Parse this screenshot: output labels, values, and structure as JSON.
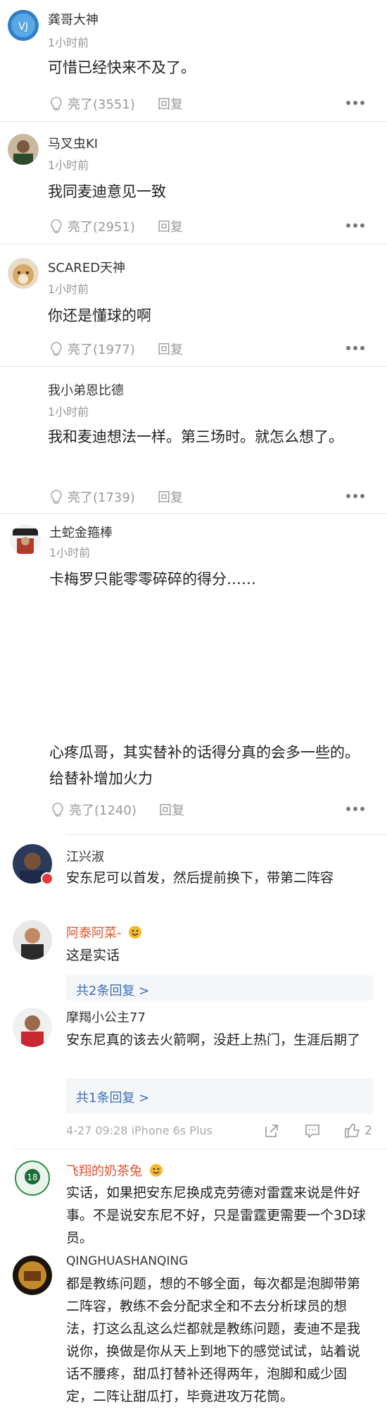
{
  "comments": [
    {
      "user": "龚哥大神",
      "time": "1小时前",
      "text": "可惜已经快来不及了。",
      "likes": "亮了(3551)",
      "reply": "回复"
    },
    {
      "user": "马叉虫KI",
      "time": "1小时前",
      "text": "我同麦迪意见一致",
      "likes": "亮了(2951)",
      "reply": "回复"
    },
    {
      "user": "SCARED天神",
      "time": "1小时前",
      "text": "你还是懂球的啊",
      "likes": "亮了(1977)",
      "reply": "回复"
    },
    {
      "user": "我小弟恩比德",
      "time": "1小时前",
      "text": "我和麦迪想法一样。第三场时。就怎么想了。",
      "likes": "亮了(1739)",
      "reply": "回复"
    },
    {
      "user": "土蛇金箍棒",
      "time": "1小时前",
      "text": "卡梅罗只能零零碎碎的得分……",
      "text2": "心疼瓜哥，其实替补的话得分真的会多一些的。给替补增加火力",
      "likes": "亮了(1240)",
      "reply": "回复"
    }
  ],
  "thread1": {
    "user": "江兴淑",
    "text": "安东尼可以首发，然后提前换下，带第二阵容",
    "replies": [
      {
        "user": "阿泰阿菜-",
        "text": "这是实话"
      }
    ],
    "more": "共2条回复 >"
  },
  "thread2": {
    "user": "摩羯小公主77",
    "text": "安东尼真的该去火箭啊，没赶上热门，生涯后期了",
    "more": "共1条回复 >",
    "meta": "4-27 09:28 iPhone 6s Plus",
    "like_count": "2"
  },
  "thread3": {
    "user": "飞翔的奶茶兔",
    "text": "实话，如果把安东尼换成克劳德对雷霆来说是件好事。不是说安东尼不好，只是雷霆更需要一个3D球员。"
  },
  "thread4": {
    "user": "QINGHUASHANQING",
    "text": "都是教练问题，想的不够全面，每次都是泡脚带第二阵容，教练不会分配求全和不去分析球员的想法，打这么乱这么烂都就是教练问题，麦迪不是我说你，换做是你从天上到地下的感觉试试，站着说话不腰疼，甜瓜打替补还得两年，泡脚和威少固定，二阵让甜瓜打，毕竟进攻万花筒。"
  },
  "colors": {
    "accent": "#e0542e",
    "link": "#3a6fb8",
    "muted": "#999999"
  },
  "icons": [
    "like-icon",
    "more-dots-icon",
    "share-icon",
    "comment-icon",
    "thumb-up-icon",
    "emoji-badge-icon"
  ]
}
